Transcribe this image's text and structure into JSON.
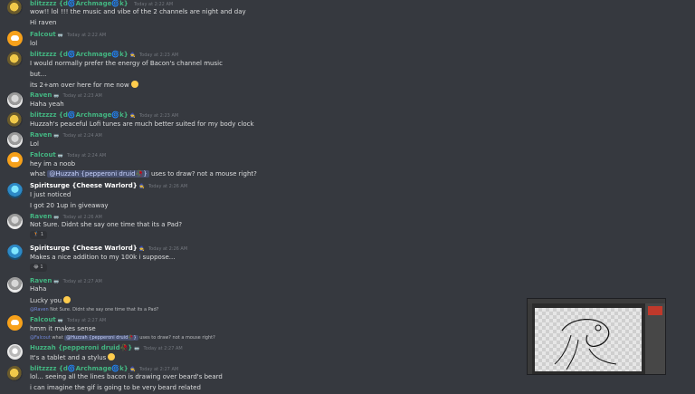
{
  "messages": [
    {
      "author": "",
      "text": "wow!! lol !!! the music and vibe of the 2 channels are night and day"
    },
    {
      "author": "",
      "text": "Hi raven"
    },
    {
      "author": "Falcout",
      "badge": "🥽",
      "time": "Today at 2:22 AM",
      "text": "lol"
    },
    {
      "author": "blitzzzz {d🌀Archmage🌀k}",
      "badge": "🧙",
      "time": "Today at 2:23 AM",
      "text": "I would normally prefer the energy of Bacon's channel music"
    },
    {
      "author": "",
      "text": "but..."
    },
    {
      "author": "",
      "text": "its 2+am over here for me now"
    },
    {
      "author": "Raven",
      "badge": "🥽",
      "time": "Today at 2:23 AM",
      "text": "Haha yeah"
    },
    {
      "author": "blitzzzz {d🌀Archmage🌀k}",
      "badge": "🧙",
      "time": "Today at 2:23 AM",
      "text": "Huzzah's peaceful Lofi tunes are much better suited for my body clock"
    },
    {
      "author": "Raven",
      "badge": "🥽",
      "time": "Today at 2:24 AM",
      "text": "Lol"
    },
    {
      "author": "Falcout",
      "badge": "🥽",
      "time": "Today at 2:24 AM",
      "text": "hey im a noob"
    },
    {
      "author": "",
      "text_pre": "what ",
      "mention": "@Huzzah {pepperoni druid🥀}",
      "text_post": " uses to draw? not a mouse right?"
    },
    {
      "author": "Spiritsurge {Cheese Warlord}",
      "badge": "🧙",
      "time": "Today at 2:26 AM",
      "text": "I just noticed"
    },
    {
      "author": "",
      "text": "I got 20 1up in giveaway"
    },
    {
      "author": "Raven",
      "badge": "🥽",
      "time": "Today at 2:26 AM",
      "text": "Not Sure. Didnt she say one time that its a Pad?"
    },
    {
      "author": "Spiritsurge {Cheese Warlord}",
      "badge": "🧙",
      "time": "Today at 2:26 AM",
      "text": "Makes a nice addition to my 100k i suppose..."
    },
    {
      "author": "Raven",
      "badge": "🥽",
      "time": "Today at 2:27 AM",
      "text": "Haha"
    },
    {
      "author": "",
      "text": "Lucky you"
    },
    {
      "reply_name": "@Raven",
      "reply_text": "Not Sure. Didnt she say one time that its a Pad?"
    },
    {
      "author": "Falcout",
      "badge": "🥽",
      "time": "Today at 2:27 AM",
      "text": "hmm it makes sense"
    },
    {
      "reply_name": "@Falcout",
      "reply_text_pre": "what ",
      "reply_mention": "@Huzzah {pepperoni druid🥀}",
      "reply_text_post": " uses to draw? not a mouse right?"
    },
    {
      "author": "Huzzah {pepperoni druid🥀}",
      "badge": "🥽",
      "time": "Today at 2:27 AM",
      "text": "It's a tablet and a stylus"
    },
    {
      "author": "blitzzzz {d🌀Archmage🌀k}",
      "badge": "🧙",
      "time": "Today at 2:27 AM",
      "text": "lol... seeing all the lines bacon is drawing over beard's beard"
    },
    {
      "author": "",
      "text": "i can imagine the gif is going to be very beard related"
    }
  ],
  "reactions": {
    "r1": "🏌 1",
    "r2": "😂 1"
  }
}
